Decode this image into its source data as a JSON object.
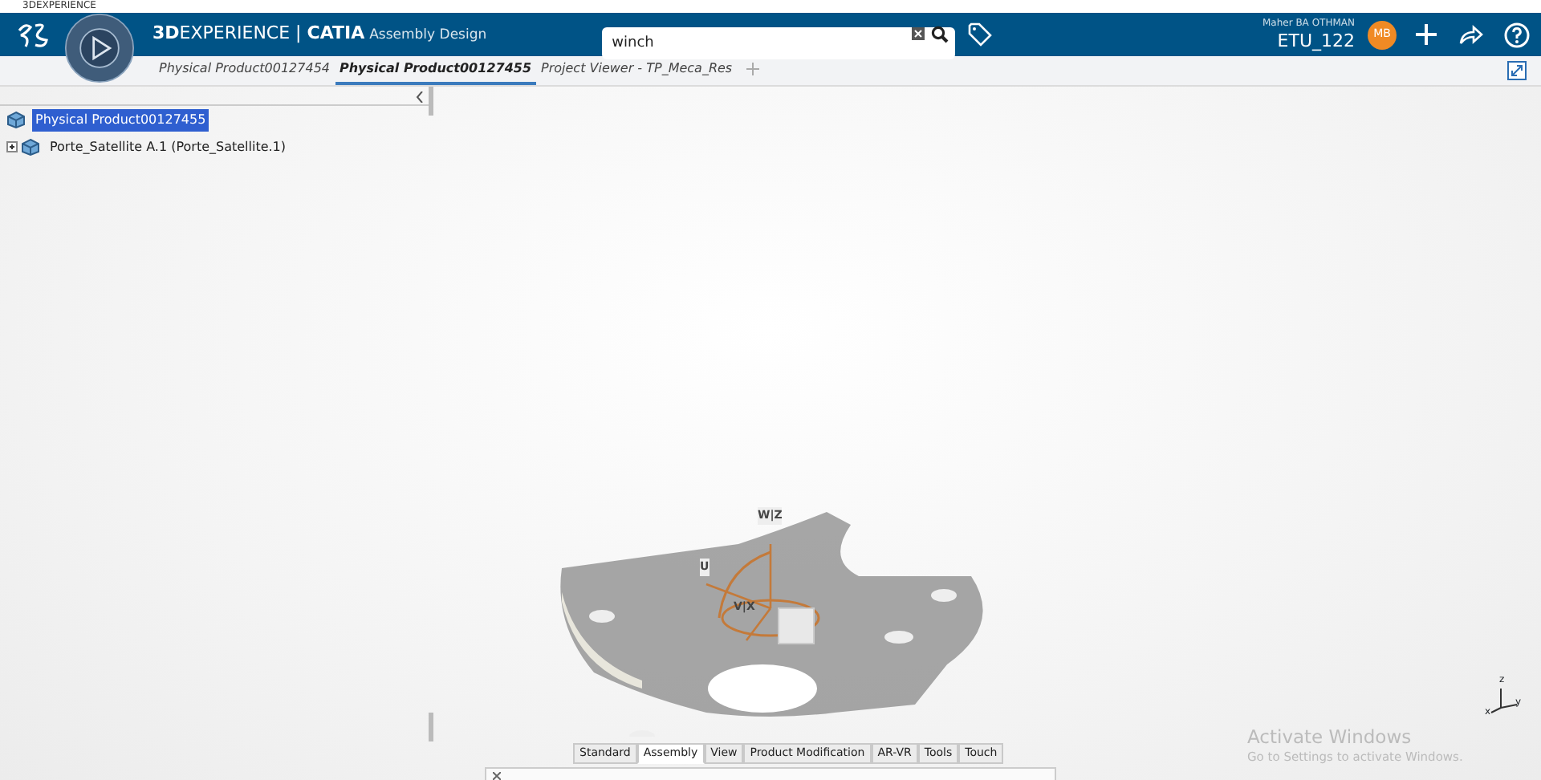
{
  "window": {
    "title": "3DEXPERIENCE"
  },
  "topbar": {
    "brand": "**3D**EXPERIENCE | **CATIA**",
    "app": "Assembly Design",
    "search": {
      "value": "winch"
    },
    "user": {
      "name": "Maher BA OTHMAN",
      "role": "ETU_122",
      "initials": "MB"
    }
  },
  "doc_tabs": [
    {
      "label": "Physical Product00127454",
      "selected": false
    },
    {
      "label": "Physical Product00127455",
      "selected": true
    },
    {
      "label": "Project Viewer - TP_Meca_Res",
      "selected": false
    }
  ],
  "tree": {
    "items": [
      {
        "label": "Physical Product00127455",
        "selected": true,
        "children": [
          {
            "label": "Porte_Satellite A.1 (Porte_Satellite.1)",
            "selected": false
          }
        ]
      }
    ]
  },
  "viewer": {
    "robot_labels": [
      "W|Z",
      "U",
      "V|X"
    ],
    "axis_labels": [
      "z",
      "x",
      "y"
    ]
  },
  "action_bar": {
    "tabs": [
      {
        "label": "Standard",
        "selected": false
      },
      {
        "label": "Assembly",
        "selected": true
      },
      {
        "label": "View",
        "selected": false
      },
      {
        "label": "Product Modification",
        "selected": false
      },
      {
        "label": "AR-VR",
        "selected": false
      },
      {
        "label": "Tools",
        "selected": false
      },
      {
        "label": "Touch",
        "selected": false
      }
    ]
  },
  "activation_notice": {
    "title": "Activate Windows",
    "text": "Go to Settings to activate Windows."
  }
}
